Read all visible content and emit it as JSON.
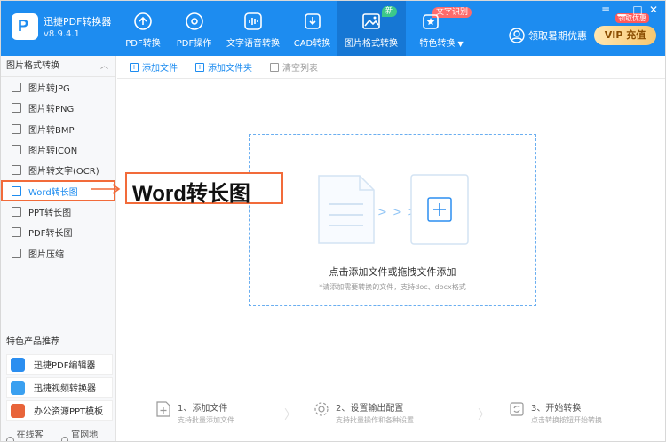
{
  "app": {
    "name": "迅捷PDF转换器",
    "version": "v8.9.4.1",
    "logo_letter": "P"
  },
  "nav": [
    {
      "label": "PDF转换",
      "icon": "pdf-convert-icon"
    },
    {
      "label": "PDF操作",
      "icon": "pdf-operate-icon"
    },
    {
      "label": "文字语音转换",
      "icon": "audio-wave-icon"
    },
    {
      "label": "CAD转换",
      "icon": "cad-icon"
    },
    {
      "label": "图片格式转换",
      "icon": "image-icon",
      "active": true,
      "badge": "新"
    },
    {
      "label": "特色转换",
      "icon": "star-convert-icon",
      "badge": "文字识别",
      "dropdown": "▼"
    }
  ],
  "header_right": {
    "user_label": "领取暑期优惠",
    "vip_label": "VIP 充值",
    "vip_tag": "领取优惠"
  },
  "window": {
    "menu": "≡",
    "minimize": "▁",
    "maximize": "□",
    "close": "✕"
  },
  "sidebar": {
    "section_title": "图片格式转换",
    "collapse": "︿",
    "items": [
      {
        "label": "图片转JPG"
      },
      {
        "label": "图片转PNG"
      },
      {
        "label": "图片转BMP"
      },
      {
        "label": "图片转ICON"
      },
      {
        "label": "图片转文字(OCR)"
      },
      {
        "label": "Word转长图",
        "active": true
      },
      {
        "label": "PPT转长图"
      },
      {
        "label": "PDF转长图"
      },
      {
        "label": "图片压缩"
      }
    ],
    "recommend_title": "特色产品推荐",
    "products": [
      {
        "label": "迅捷PDF编辑器",
        "color": "#2b8ef0"
      },
      {
        "label": "迅捷视频转换器",
        "color": "#3aa0f0"
      },
      {
        "label": "办公资源PPT模板",
        "color": "#e8643a"
      }
    ],
    "footer": {
      "service": "在线客服",
      "website": "官网地址"
    }
  },
  "toolbar": {
    "add_file": "添加文件",
    "add_folder": "添加文件夹",
    "clear_list": "清空列表"
  },
  "dropzone": {
    "arrows": "> > >",
    "main_text": "点击添加文件或拖拽文件添加",
    "sub_text": "*请添加需要转换的文件，支持doc、docx格式"
  },
  "annotation": {
    "text": "Word转长图"
  },
  "steps": [
    {
      "title": "1、添加文件",
      "subtitle": "支持批量添加文件"
    },
    {
      "title": "2、设置输出配置",
      "subtitle": "支持批量操作和各种设置"
    },
    {
      "title": "3、开始转换",
      "subtitle": "点击转换按钮开始转换"
    }
  ],
  "colors": {
    "primary": "#1d8cf0",
    "highlight": "#f26b3a"
  }
}
